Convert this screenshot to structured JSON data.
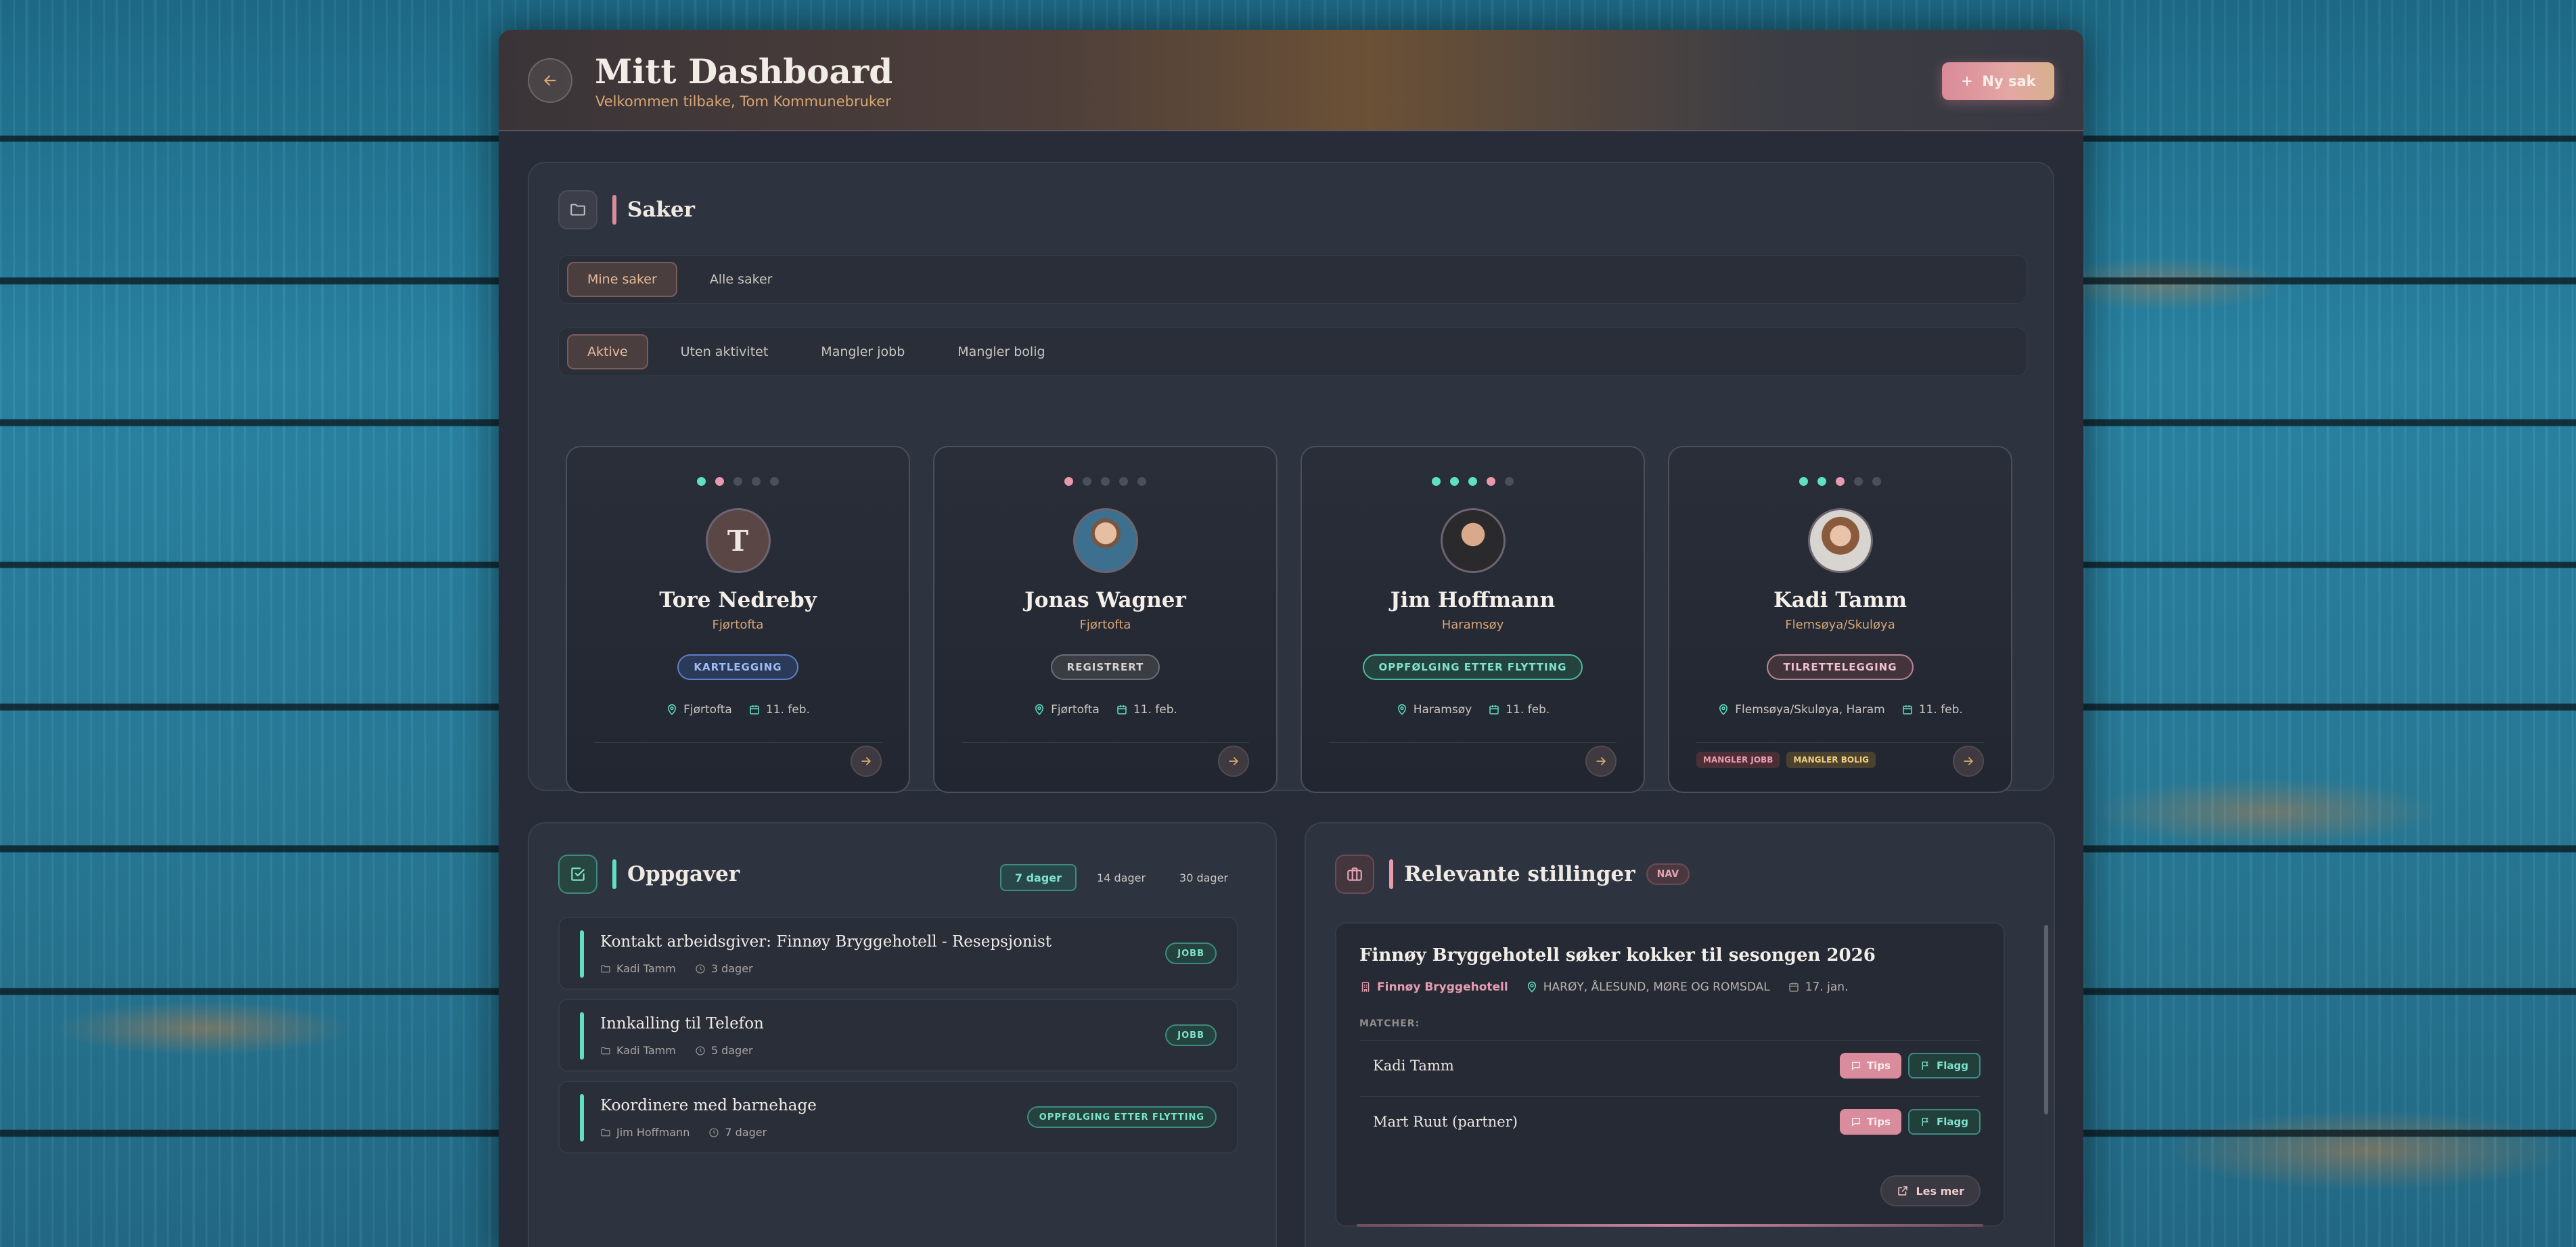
{
  "colors": {
    "accent_pink": "#d98c9c",
    "accent_teal": "#5fe0c1",
    "accent_amber": "#d9a873",
    "panel_bg": "#272c38"
  },
  "header": {
    "back_icon": "arrow-left-icon",
    "title": "Mitt Dashboard",
    "subtitle": "Velkommen tilbake, Tom Kommunebruker",
    "new_case_label": "Ny sak"
  },
  "saker": {
    "title": "Saker",
    "scope_tabs": [
      {
        "label": "Mine saker",
        "active": true
      },
      {
        "label": "Alle saker",
        "active": false
      }
    ],
    "filter_tabs": [
      {
        "label": "Aktive",
        "active": true
      },
      {
        "label": "Uten aktivitet",
        "active": false
      },
      {
        "label": "Mangler jobb",
        "active": false
      },
      {
        "label": "Mangler bolig",
        "active": false
      }
    ],
    "cases": [
      {
        "name": "Tore Nedreby",
        "initial": "T",
        "place": "Fjørtofta",
        "status": "KARTLEGGING",
        "location": "Fjørtofta",
        "date": "11. feb.",
        "progress_dots": [
          "teal",
          "pink",
          "off",
          "off",
          "off"
        ],
        "tags": []
      },
      {
        "name": "Jonas Wagner",
        "place": "Fjørtofta",
        "status": "REGISTRERT",
        "location": "Fjørtofta",
        "date": "11. feb.",
        "progress_dots": [
          "pink",
          "off",
          "off",
          "off",
          "off"
        ],
        "tags": []
      },
      {
        "name": "Jim Hoffmann",
        "place": "Haramsøy",
        "status": "OPPFØLGING ETTER FLYTTING",
        "location": "Haramsøy",
        "date": "11. feb.",
        "progress_dots": [
          "teal",
          "teal",
          "teal",
          "pink",
          "off"
        ],
        "tags": []
      },
      {
        "name": "Kadi Tamm",
        "place": "Flemsøya/Skuløya",
        "status": "TILRETTELEGGING",
        "location": "Flemsøya/Skuløya, Haram",
        "date": "11. feb.",
        "progress_dots": [
          "teal",
          "teal",
          "pink",
          "off",
          "off"
        ],
        "tags": [
          "MANGLER JOBB",
          "MANGLER BOLIG"
        ]
      }
    ]
  },
  "oppgaver": {
    "title": "Oppgaver",
    "ranges": [
      {
        "label": "7 dager",
        "active": true
      },
      {
        "label": "14 dager",
        "active": false
      },
      {
        "label": "30 dager",
        "active": false
      }
    ],
    "tasks": [
      {
        "title": "Kontakt arbeidsgiver: Finnøy Bryggehotell - Resepsjonist",
        "person": "Kadi Tamm",
        "due": "3 dager",
        "tag": "JOBB"
      },
      {
        "title": "Innkalling til Telefon",
        "person": "Kadi Tamm",
        "due": "5 dager",
        "tag": "JOBB"
      },
      {
        "title": "Koordinere med barnehage",
        "person": "Jim Hoffmann",
        "due": "7 dager",
        "tag": "OPPFØLGING ETTER FLYTTING"
      }
    ]
  },
  "stillinger": {
    "title": "Relevante stillinger",
    "badge": "NAV",
    "job": {
      "title": "Finnøy Bryggehotell søker kokker til sesongen 2026",
      "employer": "Finnøy Bryggehotell",
      "location": "HARØY, ÅLESUND, MØRE OG ROMSDAL",
      "date": "17. jan.",
      "matcher_label": "MATCHER:",
      "matches": [
        {
          "name": "Kadi Tamm",
          "tips_label": "Tips",
          "flag_label": "Flagg"
        },
        {
          "name": "Mart Ruut (partner)",
          "tips_label": "Tips",
          "flag_label": "Flagg"
        }
      ],
      "read_more_label": "Les mer"
    }
  }
}
